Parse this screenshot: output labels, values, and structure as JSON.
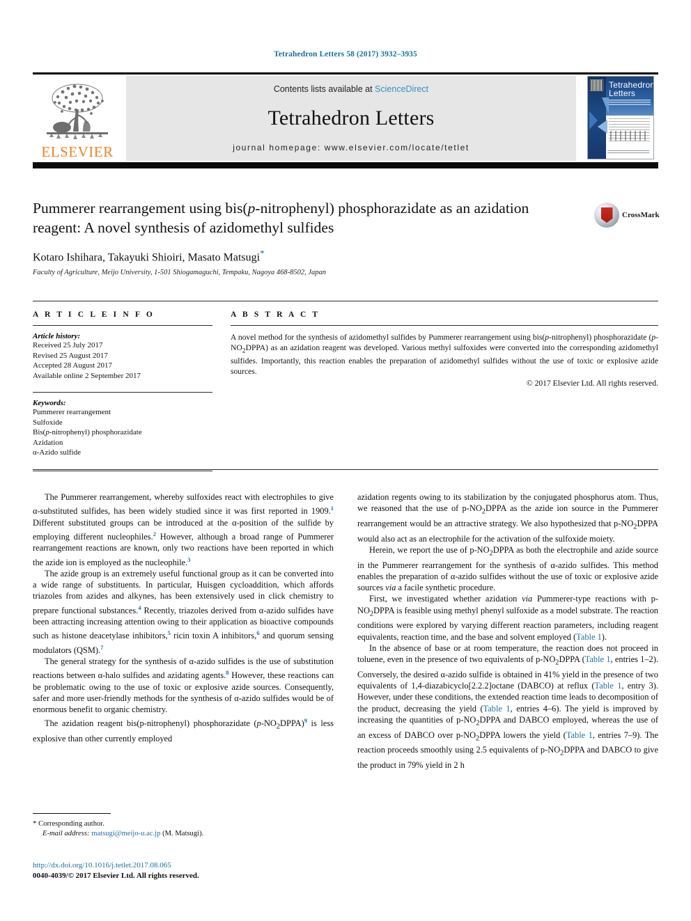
{
  "running_head": "Tetrahedron Letters 58 (2017) 3932–3935",
  "masthead": {
    "contents_prefix": "Contents lists available at ",
    "sciencedirect": "ScienceDirect",
    "journal_name": "Tetrahedron Letters",
    "homepage": "journal homepage: www.elsevier.com/locate/tetlet",
    "publisher": "ELSEVIER",
    "cover_title_line1": "Tetrahedron",
    "cover_title_line2": "Letters"
  },
  "crossmark": {
    "label": "CrossMark"
  },
  "title": {
    "line1_a": "Pummerer rearrangement using bis(",
    "line1_i": "p",
    "line1_b": "-nitrophenyl) phosphorazidate as",
    "line2": "an azidation reagent: A novel synthesis of azidomethyl sulfides"
  },
  "authors": "Kotaro Ishihara, Takayuki Shioiri, Masato Matsugi",
  "author_star": "*",
  "affiliation": "Faculty of Agriculture, Meijo University, 1-501 Shiogamaguchi, Tempaku, Nagoya 468-8502, Japan",
  "article_info": {
    "heading": "A R T I C L E   I N F O",
    "history_label": "Article history:",
    "history": [
      "Received 25 July 2017",
      "Revised 25 August 2017",
      "Accepted 28 August 2017",
      "Available online 2 September 2017"
    ],
    "keywords_label": "Keywords:",
    "keywords": [
      "Pummerer rearrangement",
      "Sulfoxide",
      "Bis(p-nitrophenyl) phosphorazidate",
      "Azidation",
      "α-Azido sulfide"
    ]
  },
  "abstract": {
    "heading": "A B S T R A C T",
    "copyright": "© 2017 Elsevier Ltd. All rights reserved."
  },
  "body": {
    "left": {
      "p1_end": " Different substituted groups can be introduced at the α-position of the sulfide by employing different nucleophiles.",
      "p2_lead": "The azide group is an extremely useful functional group as it can be converted into a wide range of substituents. In particular, Huisgen cycloaddition, which affords triazoles from azides and alkynes, has been extensively used in click chemistry to prepare functional substances.",
      "p3_lead": "The general strategy for the synthesis of α-azido sulfides is the use of substitution reactions between α-halo sulfides and azidating agents.",
      "p4_lead": "The azidation reagent bis(p-nitrophenyl) phosphorazidate"
    }
  },
  "footnote": {
    "star": "*",
    "corresponding": "Corresponding author.",
    "email_label": "E-mail address:",
    "email": "matsugi@meijo-u.ac.jp",
    "email_owner": "(M. Matsugi)."
  },
  "doi": {
    "url": "http://dx.doi.org/10.1016/j.tetlet.2017.08.065",
    "issn_line": "0040-4039/© 2017 Elsevier Ltd. All rights reserved."
  },
  "colors": {
    "link_blue": "#1a6fa3",
    "sciencedirect_blue": "#3a8fc4",
    "elsevier_orange": "#f08121",
    "band_gray": "#e6e6e6"
  }
}
